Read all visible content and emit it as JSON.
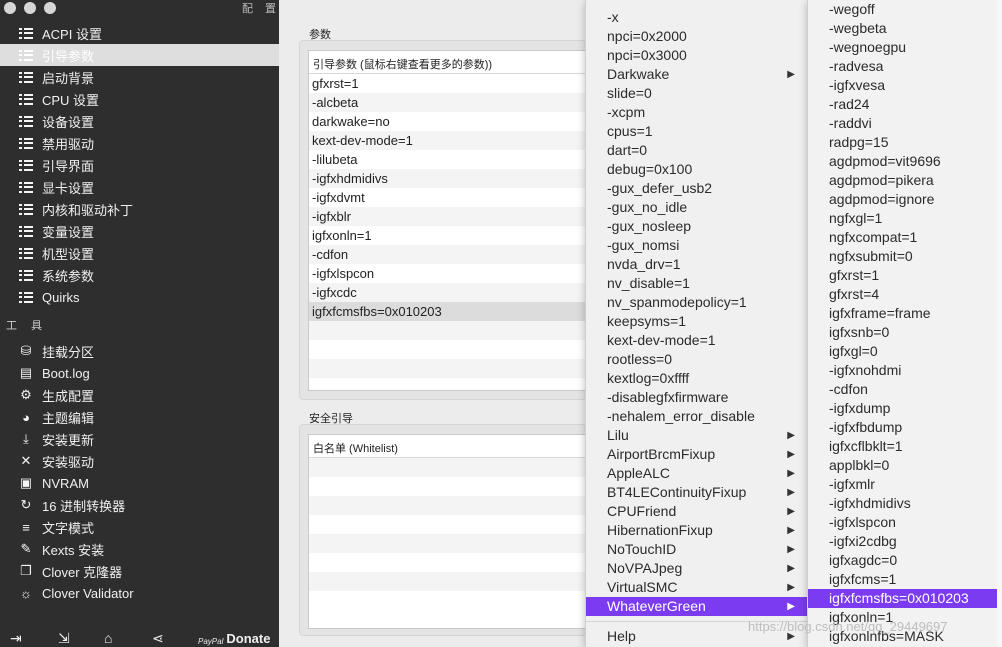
{
  "sidebar": {
    "title": "配置",
    "nav_items": [
      {
        "label": "ACPI 设置",
        "icon": "list-icon",
        "active": false
      },
      {
        "label": "引导参数",
        "icon": "list-icon",
        "active": true
      },
      {
        "label": "启动背景",
        "icon": "list-icon",
        "active": false
      },
      {
        "label": "CPU 设置",
        "icon": "list-icon",
        "active": false
      },
      {
        "label": "设备设置",
        "icon": "list-icon",
        "active": false
      },
      {
        "label": "禁用驱动",
        "icon": "list-icon",
        "active": false
      },
      {
        "label": "引导界面",
        "icon": "list-icon",
        "active": false
      },
      {
        "label": "显卡设置",
        "icon": "list-icon",
        "active": false
      },
      {
        "label": "内核和驱动补丁",
        "icon": "list-icon",
        "active": false
      },
      {
        "label": "变量设置",
        "icon": "list-icon",
        "active": false
      },
      {
        "label": "机型设置",
        "icon": "list-icon",
        "active": false
      },
      {
        "label": "系统参数",
        "icon": "list-icon",
        "active": false
      },
      {
        "label": "Quirks",
        "icon": "list-icon",
        "active": false
      }
    ],
    "tools_header": "工具",
    "tool_items": [
      {
        "label": "挂载分区",
        "icon": "disk-icon",
        "glyph": "⛁"
      },
      {
        "label": "Boot.log",
        "icon": "log-icon",
        "glyph": "▤"
      },
      {
        "label": "生成配置",
        "icon": "gears-icon",
        "glyph": "⚙"
      },
      {
        "label": "主题编辑",
        "icon": "palette-icon",
        "glyph": "◕"
      },
      {
        "label": "安装更新",
        "icon": "download-icon",
        "glyph": "⤓"
      },
      {
        "label": "安装驱动",
        "icon": "tools-icon",
        "glyph": "✕"
      },
      {
        "label": "NVRAM",
        "icon": "chip-icon",
        "glyph": "▣"
      },
      {
        "label": "16 进制转换器",
        "icon": "refresh-icon",
        "glyph": "↻"
      },
      {
        "label": "文字模式",
        "icon": "text-icon",
        "glyph": "≡"
      },
      {
        "label": "Kexts 安装",
        "icon": "brush-icon",
        "glyph": "✎"
      },
      {
        "label": "Clover 克隆器",
        "icon": "clone-icon",
        "glyph": "❐"
      },
      {
        "label": "Clover Validator",
        "icon": "bulb-icon",
        "glyph": "☼"
      }
    ],
    "bottom": {
      "paypal": "PayPal",
      "donate": "Donate"
    }
  },
  "main": {
    "args_section_label": "参数",
    "args_table_header": "引导参数 (鼠标右键查看更多的参数))",
    "args_rows": [
      "gfxrst=1",
      "-alcbeta",
      "darkwake=no",
      "kext-dev-mode=1",
      "-lilubeta",
      "-igfxhdmidivs",
      "-igfxdvmt",
      "-igfxblr",
      "igfxonln=1",
      "-cdfon",
      "-igfxlspcon",
      "-igfxcdc",
      "igfxfcmsfbs=0x010203"
    ],
    "secure_section_label": "安全引导",
    "whitelist_header": "白名单 (Whitelist)"
  },
  "menu1": {
    "items": [
      {
        "label": "-x",
        "submenu": false
      },
      {
        "label": "npci=0x2000",
        "submenu": false
      },
      {
        "label": "npci=0x3000",
        "submenu": false
      },
      {
        "label": "Darkwake",
        "submenu": true
      },
      {
        "label": "slide=0",
        "submenu": false
      },
      {
        "label": "-xcpm",
        "submenu": false
      },
      {
        "label": "cpus=1",
        "submenu": false
      },
      {
        "label": "dart=0",
        "submenu": false
      },
      {
        "label": "debug=0x100",
        "submenu": false
      },
      {
        "label": "-gux_defer_usb2",
        "submenu": false
      },
      {
        "label": "-gux_no_idle",
        "submenu": false
      },
      {
        "label": "-gux_nosleep",
        "submenu": false
      },
      {
        "label": "-gux_nomsi",
        "submenu": false
      },
      {
        "label": "nvda_drv=1",
        "submenu": false
      },
      {
        "label": "nv_disable=1",
        "submenu": false
      },
      {
        "label": "nv_spanmodepolicy=1",
        "submenu": false
      },
      {
        "label": "keepsyms=1",
        "submenu": false
      },
      {
        "label": "kext-dev-mode=1",
        "submenu": false
      },
      {
        "label": "rootless=0",
        "submenu": false
      },
      {
        "label": "kextlog=0xffff",
        "submenu": false
      },
      {
        "label": "-disablegfxfirmware",
        "submenu": false
      },
      {
        "label": "-nehalem_error_disable",
        "submenu": false
      },
      {
        "label": "Lilu",
        "submenu": true
      },
      {
        "label": "AirportBrcmFixup",
        "submenu": true
      },
      {
        "label": "AppleALC",
        "submenu": true
      },
      {
        "label": "BT4LEContinuityFixup",
        "submenu": true
      },
      {
        "label": "CPUFriend",
        "submenu": true
      },
      {
        "label": "HibernationFixup",
        "submenu": true
      },
      {
        "label": "NoTouchID",
        "submenu": true
      },
      {
        "label": "NoVPAJpeg",
        "submenu": true
      },
      {
        "label": "VirtualSMC",
        "submenu": true
      },
      {
        "label": "WhateverGreen",
        "submenu": true,
        "highlighted": true
      }
    ],
    "help_label": "Help"
  },
  "menu2": {
    "items": [
      "-wegoff",
      "-wegbeta",
      "-wegnoegpu",
      "-radvesa",
      "-igfxvesa",
      "-rad24",
      "-raddvi",
      "radpg=15",
      "agdpmod=vit9696",
      "agdpmod=pikera",
      "agdpmod=ignore",
      "ngfxgl=1",
      "ngfxcompat=1",
      "ngfxsubmit=0",
      "gfxrst=1",
      "gfxrst=4",
      "igfxframe=frame",
      "igfxsnb=0",
      "igfxgl=0",
      "-igfxnohdmi",
      "-cdfon",
      "-igfxdump",
      "-igfxfbdump",
      "igfxcflbklt=1",
      "applbkl=0",
      "-igfxmlr",
      "-igfxhdmidivs",
      "-igfxlspcon",
      "-igfxi2cdbg",
      "igfxagdc=0",
      "igfxfcms=1",
      "igfxfcmsfbs=0x010203",
      "igfxonln=1",
      "igfxonlnfbs=MASK"
    ],
    "highlighted_index": 31
  },
  "watermark": "https://blog.csdn.net/qq_29449697",
  "colors": {
    "sidebar_bg": "#2e2e2e",
    "menu_highlight": "#7b3cf1",
    "selected_row": "#dcdcdc"
  }
}
